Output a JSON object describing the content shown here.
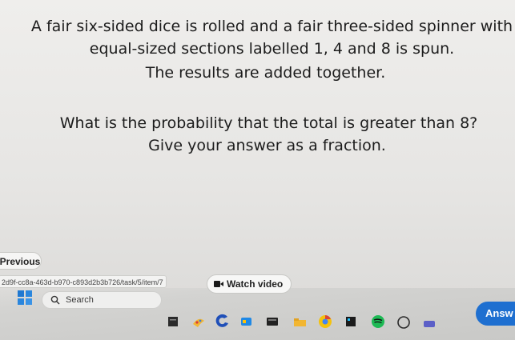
{
  "question": {
    "line1": "A fair six-sided dice is rolled and a fair three-sided spinner with",
    "line2": "equal-sized sections labelled 1, 4 and 8 is spun.",
    "line3": "The results are added together.",
    "line4": "What is the probability that the total is greater than 8?",
    "line5": "Give your answer as a fraction."
  },
  "controls": {
    "previous_label": "Previous",
    "watch_video_label": "Watch video",
    "answer_label": "Answ"
  },
  "browser": {
    "url_fragment": "2d9f-cc8a-463d-b970-c893d2b3b726/task/5/item/7"
  },
  "taskbar": {
    "search_label": "Search",
    "icons": [
      "windows-start-icon",
      "search-icon",
      "file-explorer-icon",
      "paint-icon",
      "chrome-icon",
      "store-icon",
      "news-icon",
      "folder-icon",
      "chrome-alt-icon",
      "calculator-icon",
      "spotify-icon",
      "chat-icon",
      "teams-icon"
    ]
  },
  "colors": {
    "answer_button": "#1e6fd0",
    "text": "#1c1c1c",
    "background": "#e9e8e6"
  }
}
